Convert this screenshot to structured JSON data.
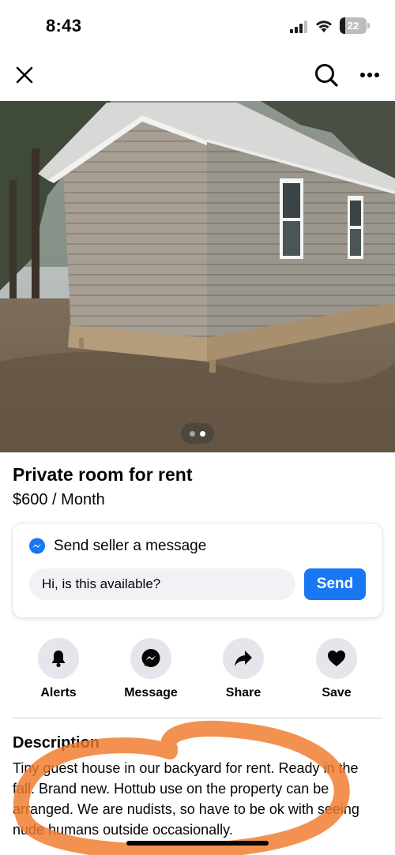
{
  "status_bar": {
    "time": "8:43",
    "battery_level": "22",
    "battery_fraction": 0.22
  },
  "nav": {
    "close_icon": "close-icon",
    "search_icon": "search-icon",
    "more_icon": "more-dots-icon"
  },
  "photo": {
    "subject": "backyard-shed-photo",
    "page_count": 2,
    "active_page": 2
  },
  "listing": {
    "title": "Private room for rent",
    "price": "$600 / Month"
  },
  "message_card": {
    "header": "Send seller a message",
    "input_value": "Hi, is this available?",
    "send_label": "Send"
  },
  "actions": [
    {
      "label": "Alerts",
      "icon": "bell-icon"
    },
    {
      "label": "Message",
      "icon": "messenger-icon"
    },
    {
      "label": "Share",
      "icon": "share-arrow-icon"
    },
    {
      "label": "Save",
      "icon": "heart-icon"
    }
  ],
  "description": {
    "heading": "Description",
    "body": "Tiny guest house in our backyard for rent. Ready in the fall. Brand new. Hottub use on the property can be arranged. We are nudists, so have to be ok with seeing nude humans outside occasionally."
  },
  "colors": {
    "accent": "#1877f2",
    "annotation": "#f07a2a",
    "icon_bg": "#e4e6eb"
  }
}
